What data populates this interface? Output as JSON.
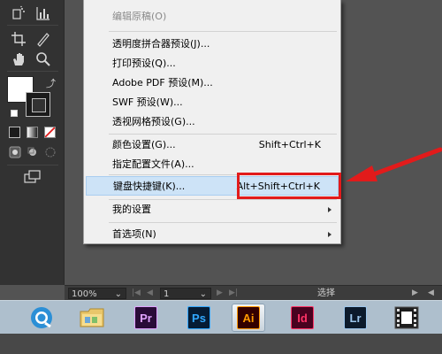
{
  "menu": {
    "items": [
      {
        "label": "编辑原稿(O)",
        "shortcut": "",
        "disabled": true,
        "submenu": false
      },
      {
        "label": "透明度拼合器预设(J)...",
        "shortcut": "",
        "disabled": false,
        "submenu": false
      },
      {
        "label": "打印预设(Q)...",
        "shortcut": "",
        "disabled": false,
        "submenu": false
      },
      {
        "label": "Adobe PDF 预设(M)...",
        "shortcut": "",
        "disabled": false,
        "submenu": false
      },
      {
        "label": "SWF 预设(W)...",
        "shortcut": "",
        "disabled": false,
        "submenu": false
      },
      {
        "label": "透视网格预设(G)...",
        "shortcut": "",
        "disabled": false,
        "submenu": false
      },
      {
        "label": "颜色设置(G)...",
        "shortcut": "Shift+Ctrl+K",
        "disabled": false,
        "submenu": false
      },
      {
        "label": "指定配置文件(A)...",
        "shortcut": "",
        "disabled": false,
        "submenu": false
      },
      {
        "label": "键盘快捷键(K)...",
        "shortcut": "Alt+Shift+Ctrl+K",
        "disabled": false,
        "submenu": false,
        "highlighted": true
      },
      {
        "label": "我的设置",
        "shortcut": "",
        "disabled": false,
        "submenu": true
      },
      {
        "label": "首选项(N)",
        "shortcut": "",
        "disabled": false,
        "submenu": true
      }
    ]
  },
  "statusbar": {
    "zoom": "100%",
    "page": "1",
    "tool_name": "选择"
  },
  "taskbar": {
    "apps": [
      {
        "name": "browser",
        "label": ""
      },
      {
        "name": "file-explorer",
        "label": ""
      },
      {
        "name": "premiere",
        "label": "Pr",
        "bg": "#2a0b38",
        "fg": "#e1a3ff"
      },
      {
        "name": "photoshop",
        "label": "Ps",
        "bg": "#061c34",
        "fg": "#31a8ff"
      },
      {
        "name": "illustrator",
        "label": "Ai",
        "bg": "#330000",
        "fg": "#ff9a00",
        "active": true
      },
      {
        "name": "indesign",
        "label": "Id",
        "bg": "#49021f",
        "fg": "#ff3366"
      },
      {
        "name": "lightroom",
        "label": "Lr",
        "bg": "#0c1a2b",
        "fg": "#9dc6ec"
      },
      {
        "name": "video",
        "label": ""
      }
    ]
  },
  "colors": {
    "highlight": "#cde3f7",
    "annotation_red": "#e21b1b",
    "panel": "#323232",
    "canvas": "#535353"
  }
}
